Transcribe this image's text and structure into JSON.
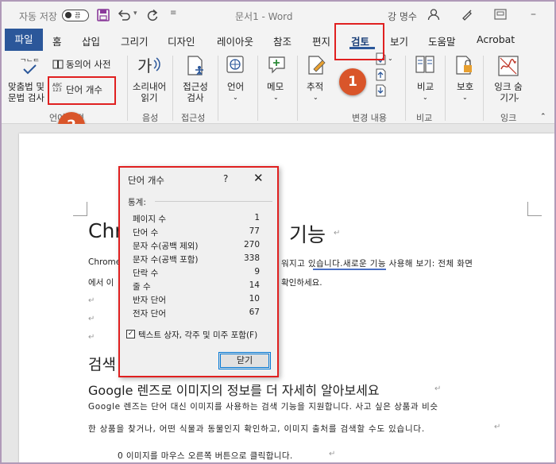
{
  "titlebar": {
    "autosave_label": "자동 저장",
    "autosave_state": "끔",
    "doc_title": "문서1 - Word",
    "user_name": "강 명수"
  },
  "tabs": {
    "file": "파일",
    "items": [
      "홈",
      "삽입",
      "그리기",
      "디자인",
      "레이아웃",
      "참조",
      "편지",
      "검토",
      "보기",
      "도움말",
      "Acrobat"
    ]
  },
  "ribbon": {
    "spelling": "맞춤법 및\n문법 검사",
    "thesaurus": "동의어 사전",
    "word_count": "단어 개수",
    "word_count_icon_text": "ABC\n123",
    "group_proofing": "언어 교정",
    "read_aloud": "소리내어\n읽기",
    "group_speech": "음성",
    "accessibility": "접근성\n검사",
    "group_accessibility": "접근성",
    "language": "언어",
    "comments": "메모",
    "tracking": "추적",
    "group_changes": "변경 내용",
    "compare": "비교",
    "group_compare": "비교",
    "protect": "보호",
    "ink": "잉크 숨\n기기",
    "group_ink": "잉크"
  },
  "callouts": {
    "one": "1",
    "two": "2"
  },
  "document": {
    "heading1_left": "Chro",
    "heading1_right": "기능",
    "line1_left": "Chrome",
    "line1_right": "워지고 있습니다.새로운 기능 사용해 보기: 전체 화면",
    "line2_left": "에서 이",
    "line2_right": "확인하세요.",
    "heading2": "검색",
    "heading3": "Google 렌즈로 이미지의 정보를 더 자세히 알아보세요",
    "body1": "Google 렌즈는 단어 대신 이미지를 사용하는 검색 기능을 지원합니다. 사고 싶은 상품과 비슷",
    "body2": "한 상품을 찾거나, 어떤 식물과 동물인지 확인하고, 이미지 출처를 검색할 수도 있습니다.",
    "body3": "0 이미지를 마우스 오른쪽 버튼으로 클릭합니다."
  },
  "dialog": {
    "title": "단어 개수",
    "help": "?",
    "close_x": "✕",
    "section": "통계:",
    "stats": [
      {
        "label": "페이지 수",
        "value": "1"
      },
      {
        "label": "단어 수",
        "value": "77"
      },
      {
        "label": "문자 수(공백 제외)",
        "value": "270"
      },
      {
        "label": "문자 수(공백 포함)",
        "value": "338"
      },
      {
        "label": "단락 수",
        "value": "9"
      },
      {
        "label": "줄 수",
        "value": "14"
      },
      {
        "label": "반자 단어",
        "value": "10"
      },
      {
        "label": "전자 단어",
        "value": "67"
      }
    ],
    "checkbox_label": "텍스트 상자, 각주 및 미주 포함(F)",
    "close_button": "닫기"
  },
  "colors": {
    "file_tab": "#2b579a",
    "highlight_box": "#e02020",
    "badge": "#d9552a"
  }
}
